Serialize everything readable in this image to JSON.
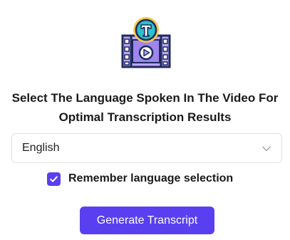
{
  "dialog": {
    "logo_icon": "film-transcript-icon",
    "heading_line1": "Select The Language Spoken In The Video For",
    "heading_line2": "Optimal Transcription Results",
    "language_select": {
      "value": "English",
      "icon": "chevron-down-icon"
    },
    "remember": {
      "checked": true,
      "label": "Remember language selection",
      "icon": "checkmark-icon"
    },
    "generate_label": "Generate Transcript"
  },
  "colors": {
    "accent": "#5A3FF0",
    "logo_yellow": "#F5C84B",
    "logo_teal": "#28C1CC",
    "logo_lavender": "#B9A5F4",
    "logo_outline": "#1F2A5C"
  }
}
